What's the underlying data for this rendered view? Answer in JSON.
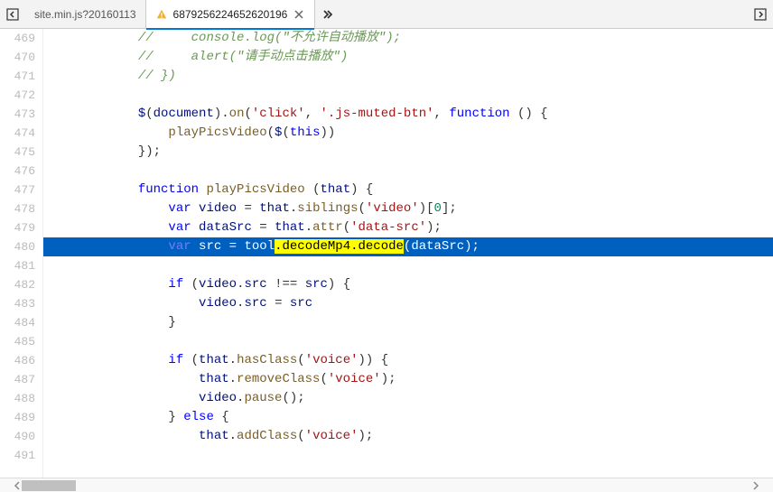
{
  "tabs": {
    "prev_icon": "back",
    "items": [
      {
        "label": "site.min.js?20160113",
        "active": false,
        "warn": false
      },
      {
        "label": "6879256224652620196",
        "active": true,
        "warn": true
      }
    ],
    "overflow_icon": "chevrons",
    "dock_icon": "dock"
  },
  "code": {
    "first_line": 469,
    "selected_line": 480,
    "highlight_text": ".decodeMp4.decode",
    "lines": [
      {
        "n": 469,
        "indent": 12,
        "tokens": [
          [
            "c-comment",
            "//     console.log(\"不允许自动播放\");"
          ]
        ]
      },
      {
        "n": 470,
        "indent": 12,
        "tokens": [
          [
            "c-comment",
            "//     alert(\"请手动点击播放\")"
          ]
        ]
      },
      {
        "n": 471,
        "indent": 12,
        "tokens": [
          [
            "c-comment",
            "// })"
          ]
        ]
      },
      {
        "n": 472,
        "indent": 0,
        "tokens": []
      },
      {
        "n": 473,
        "indent": 12,
        "tokens": [
          [
            "c-ident",
            "$"
          ],
          [
            "c-plain",
            "("
          ],
          [
            "c-ident",
            "document"
          ],
          [
            "c-plain",
            ")."
          ],
          [
            "c-func",
            "on"
          ],
          [
            "c-plain",
            "("
          ],
          [
            "c-str",
            "'click'"
          ],
          [
            "c-plain",
            ", "
          ],
          [
            "c-str",
            "'.js-muted-btn'"
          ],
          [
            "c-plain",
            ", "
          ],
          [
            "c-key",
            "function"
          ],
          [
            "c-plain",
            " () {"
          ]
        ]
      },
      {
        "n": 474,
        "indent": 16,
        "tokens": [
          [
            "c-func",
            "playPicsVideo"
          ],
          [
            "c-plain",
            "("
          ],
          [
            "c-ident",
            "$"
          ],
          [
            "c-plain",
            "("
          ],
          [
            "c-this",
            "this"
          ],
          [
            "c-plain",
            "))"
          ]
        ]
      },
      {
        "n": 475,
        "indent": 12,
        "tokens": [
          [
            "c-plain",
            "});"
          ]
        ]
      },
      {
        "n": 476,
        "indent": 0,
        "tokens": []
      },
      {
        "n": 477,
        "indent": 12,
        "tokens": [
          [
            "c-key",
            "function"
          ],
          [
            "c-plain",
            " "
          ],
          [
            "c-func",
            "playPicsVideo"
          ],
          [
            "c-plain",
            " ("
          ],
          [
            "c-ident",
            "that"
          ],
          [
            "c-plain",
            ") {"
          ]
        ]
      },
      {
        "n": 478,
        "indent": 16,
        "tokens": [
          [
            "c-key",
            "var"
          ],
          [
            "c-plain",
            " "
          ],
          [
            "c-ident",
            "video"
          ],
          [
            "c-plain",
            " = "
          ],
          [
            "c-ident",
            "that"
          ],
          [
            "c-plain",
            "."
          ],
          [
            "c-func",
            "siblings"
          ],
          [
            "c-plain",
            "("
          ],
          [
            "c-str",
            "'video'"
          ],
          [
            "c-plain",
            ")["
          ],
          [
            "c-num",
            "0"
          ],
          [
            "c-plain",
            "];"
          ]
        ]
      },
      {
        "n": 479,
        "indent": 16,
        "tokens": [
          [
            "c-key",
            "var"
          ],
          [
            "c-plain",
            " "
          ],
          [
            "c-ident",
            "dataSrc"
          ],
          [
            "c-plain",
            " = "
          ],
          [
            "c-ident",
            "that"
          ],
          [
            "c-plain",
            "."
          ],
          [
            "c-func",
            "attr"
          ],
          [
            "c-plain",
            "("
          ],
          [
            "c-str",
            "'data-src'"
          ],
          [
            "c-plain",
            ");"
          ]
        ]
      },
      {
        "n": 480,
        "indent": 16,
        "sel": true,
        "tokens": [
          [
            "c-key",
            "var"
          ],
          [
            "c-plain",
            " "
          ],
          [
            "c-ident",
            "src"
          ],
          [
            "c-plain",
            " = "
          ],
          [
            "c-ident",
            "tool"
          ],
          [
            "hl",
            ".decodeMp4.decode"
          ],
          [
            "c-plain",
            "("
          ],
          [
            "c-ident",
            "dataSrc"
          ],
          [
            "c-plain",
            ");"
          ]
        ]
      },
      {
        "n": 481,
        "indent": 0,
        "tokens": []
      },
      {
        "n": 482,
        "indent": 16,
        "tokens": [
          [
            "c-key",
            "if"
          ],
          [
            "c-plain",
            " ("
          ],
          [
            "c-ident",
            "video"
          ],
          [
            "c-plain",
            "."
          ],
          [
            "c-ident",
            "src"
          ],
          [
            "c-plain",
            " !== "
          ],
          [
            "c-ident",
            "src"
          ],
          [
            "c-plain",
            ") {"
          ]
        ]
      },
      {
        "n": 483,
        "indent": 20,
        "tokens": [
          [
            "c-ident",
            "video"
          ],
          [
            "c-plain",
            "."
          ],
          [
            "c-ident",
            "src"
          ],
          [
            "c-plain",
            " = "
          ],
          [
            "c-ident",
            "src"
          ]
        ]
      },
      {
        "n": 484,
        "indent": 16,
        "tokens": [
          [
            "c-plain",
            "}"
          ]
        ]
      },
      {
        "n": 485,
        "indent": 0,
        "tokens": []
      },
      {
        "n": 486,
        "indent": 16,
        "tokens": [
          [
            "c-key",
            "if"
          ],
          [
            "c-plain",
            " ("
          ],
          [
            "c-ident",
            "that"
          ],
          [
            "c-plain",
            "."
          ],
          [
            "c-func",
            "hasClass"
          ],
          [
            "c-plain",
            "("
          ],
          [
            "c-str",
            "'voice'"
          ],
          [
            "c-plain",
            ")) {"
          ]
        ]
      },
      {
        "n": 487,
        "indent": 20,
        "tokens": [
          [
            "c-ident",
            "that"
          ],
          [
            "c-plain",
            "."
          ],
          [
            "c-func",
            "removeClass"
          ],
          [
            "c-plain",
            "("
          ],
          [
            "c-str",
            "'voice'"
          ],
          [
            "c-plain",
            ");"
          ]
        ]
      },
      {
        "n": 488,
        "indent": 20,
        "tokens": [
          [
            "c-ident",
            "video"
          ],
          [
            "c-plain",
            "."
          ],
          [
            "c-func",
            "pause"
          ],
          [
            "c-plain",
            "();"
          ]
        ]
      },
      {
        "n": 489,
        "indent": 16,
        "tokens": [
          [
            "c-plain",
            "} "
          ],
          [
            "c-key",
            "else"
          ],
          [
            "c-plain",
            " {"
          ]
        ]
      },
      {
        "n": 490,
        "indent": 20,
        "tokens": [
          [
            "c-ident",
            "that"
          ],
          [
            "c-plain",
            "."
          ],
          [
            "c-func",
            "addClass"
          ],
          [
            "c-plain",
            "("
          ],
          [
            "c-str",
            "'voice'"
          ],
          [
            "c-plain",
            ");"
          ]
        ]
      },
      {
        "n": 491,
        "indent": 0,
        "tokens": []
      }
    ]
  }
}
